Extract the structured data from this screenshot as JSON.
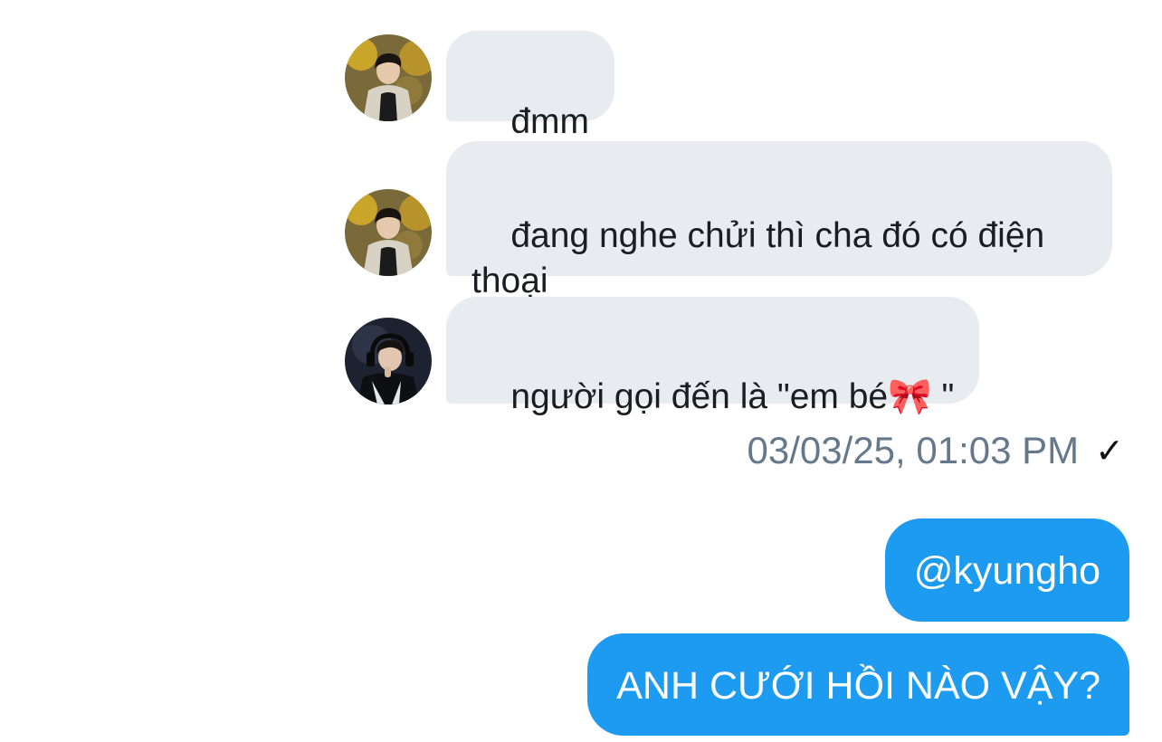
{
  "conversation": {
    "messages_in": [
      {
        "text": "đmm",
        "avatar": "avatar-photo-man-jacket"
      },
      {
        "text": "đang nghe chửi thì cha đó có điện\nthoại",
        "avatar": "avatar-photo-man-jacket"
      },
      {
        "text": "người gọi đến là \"em bé🎀 \"",
        "avatar": "avatar-photo-gamer-headset"
      }
    ],
    "timestamp": "03/03/25, 01:03 PM",
    "status_icon": "check-icon",
    "messages_out": [
      {
        "text": "@kyungho"
      },
      {
        "text": "ANH CƯỚI HỒI NÀO VẬY?"
      }
    ]
  },
  "colors": {
    "incoming_bubble": "#e8ecf1",
    "outgoing_bubble": "#1d9bf0",
    "timestamp_text": "#66798c"
  }
}
